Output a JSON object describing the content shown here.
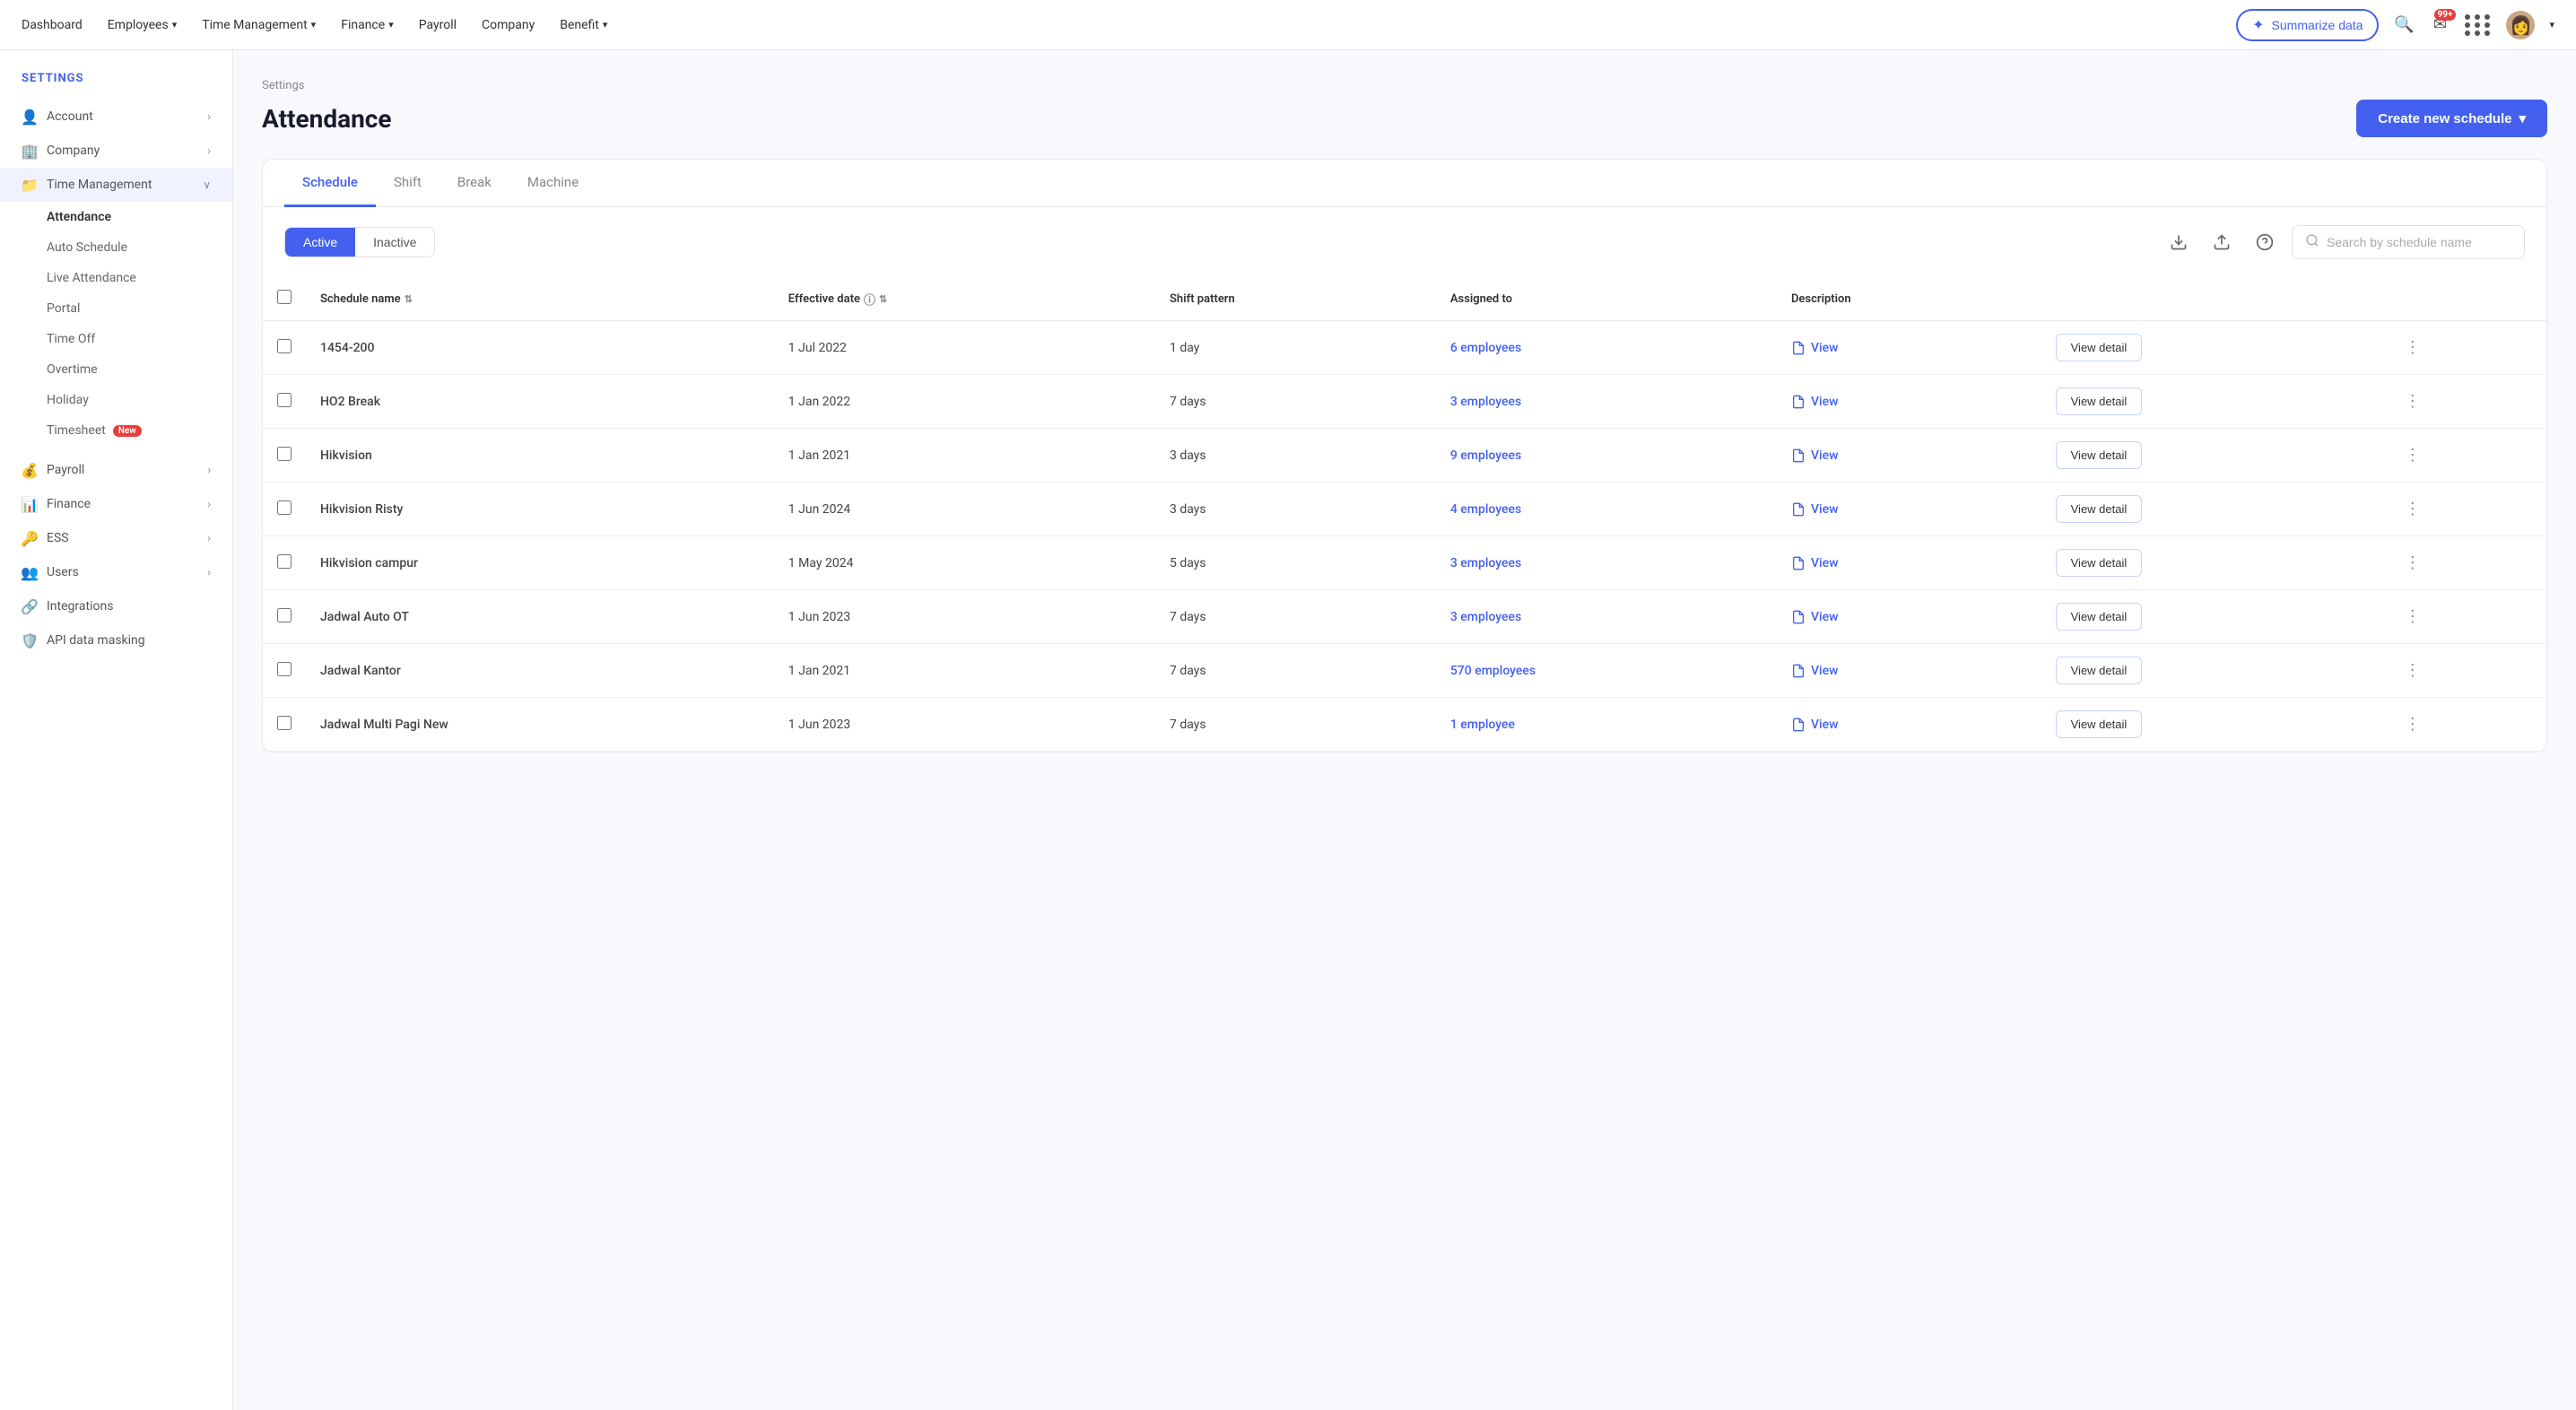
{
  "topnav": {
    "items": [
      {
        "label": "Dashboard",
        "has_dropdown": false
      },
      {
        "label": "Employees",
        "has_dropdown": true
      },
      {
        "label": "Time Management",
        "has_dropdown": true
      },
      {
        "label": "Finance",
        "has_dropdown": true
      },
      {
        "label": "Payroll",
        "has_dropdown": false
      },
      {
        "label": "Company",
        "has_dropdown": false
      },
      {
        "label": "Benefit",
        "has_dropdown": true
      }
    ],
    "summarize_label": "Summarize data",
    "notification_count": "99+"
  },
  "sidebar": {
    "settings_label": "SETTINGS",
    "items": [
      {
        "id": "account",
        "label": "Account",
        "icon": "👤",
        "has_arrow": true,
        "active": false
      },
      {
        "id": "company",
        "label": "Company",
        "icon": "🏢",
        "has_arrow": true,
        "active": false
      },
      {
        "id": "time-management",
        "label": "Time Management",
        "icon": "📁",
        "has_arrow": true,
        "active": true,
        "expanded": true
      }
    ],
    "subitems": [
      {
        "label": "Attendance",
        "active": true
      },
      {
        "label": "Auto Schedule",
        "active": false
      },
      {
        "label": "Live Attendance",
        "active": false
      },
      {
        "label": "Portal",
        "active": false
      },
      {
        "label": "Time Off",
        "active": false
      },
      {
        "label": "Overtime",
        "active": false
      },
      {
        "label": "Holiday",
        "active": false
      },
      {
        "label": "Timesheet",
        "active": false,
        "badge": "New"
      }
    ],
    "bottom_items": [
      {
        "id": "payroll",
        "label": "Payroll",
        "icon": "💰",
        "has_arrow": true
      },
      {
        "id": "finance",
        "label": "Finance",
        "icon": "📊",
        "has_arrow": true
      },
      {
        "id": "ess",
        "label": "ESS",
        "icon": "🔑",
        "has_arrow": true
      },
      {
        "id": "users",
        "label": "Users",
        "icon": "👥",
        "has_arrow": true
      },
      {
        "id": "integrations",
        "label": "Integrations",
        "icon": "🔗",
        "has_arrow": false
      },
      {
        "id": "api-data-masking",
        "label": "API data masking",
        "icon": "🛡️",
        "has_arrow": false
      }
    ]
  },
  "breadcrumb": "Settings",
  "page_title": "Attendance",
  "create_btn_label": "Create new schedule",
  "tabs": [
    {
      "label": "Schedule",
      "active": true
    },
    {
      "label": "Shift",
      "active": false
    },
    {
      "label": "Break",
      "active": false
    },
    {
      "label": "Machine",
      "active": false
    }
  ],
  "filter": {
    "active_label": "Active",
    "inactive_label": "Inactive",
    "search_placeholder": "Search by schedule name"
  },
  "table": {
    "columns": [
      {
        "label": "Schedule name",
        "sortable": true
      },
      {
        "label": "Effective date",
        "info": true,
        "sortable": true
      },
      {
        "label": "Shift pattern"
      },
      {
        "label": "Assigned to"
      },
      {
        "label": "Description"
      }
    ],
    "rows": [
      {
        "name": "1454-200",
        "effective_date": "1 Jul 2022",
        "shift_pattern": "1 day",
        "assigned_to": "6 employees",
        "has_description": true
      },
      {
        "name": "HO2 Break",
        "effective_date": "1 Jan 2022",
        "shift_pattern": "7 days",
        "assigned_to": "3 employees",
        "has_description": true
      },
      {
        "name": "Hikvision",
        "effective_date": "1 Jan 2021",
        "shift_pattern": "3 days",
        "assigned_to": "9 employees",
        "has_description": true
      },
      {
        "name": "Hikvision Risty",
        "effective_date": "1 Jun 2024",
        "shift_pattern": "3 days",
        "assigned_to": "4 employees",
        "has_description": true
      },
      {
        "name": "Hikvision campur",
        "effective_date": "1 May 2024",
        "shift_pattern": "5 days",
        "assigned_to": "3 employees",
        "has_description": true
      },
      {
        "name": "Jadwal Auto OT",
        "effective_date": "1 Jun 2023",
        "shift_pattern": "7 days",
        "assigned_to": "3 employees",
        "has_description": true
      },
      {
        "name": "Jadwal Kantor",
        "effective_date": "1 Jan 2021",
        "shift_pattern": "7 days",
        "assigned_to": "570 employees",
        "has_description": true
      },
      {
        "name": "Jadwal Multi Pagi New",
        "effective_date": "1 Jun 2023",
        "shift_pattern": "7 days",
        "assigned_to": "1 employee",
        "has_description": true
      }
    ],
    "view_label": "View",
    "view_detail_label": "View detail"
  }
}
